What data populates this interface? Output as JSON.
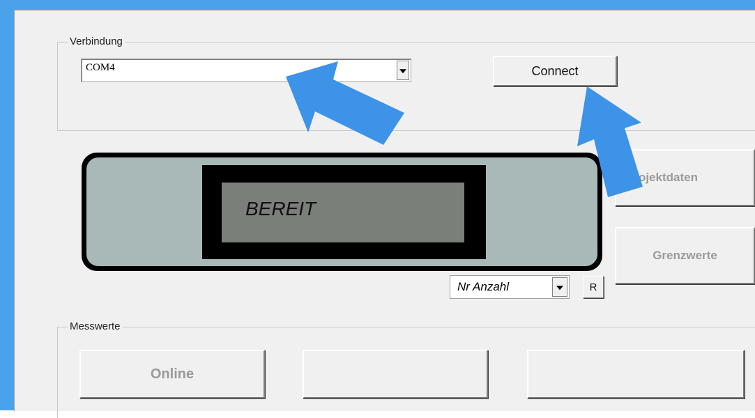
{
  "verbindung": {
    "group_label": "Verbindung",
    "port_value": "COM4",
    "connect_label": "Connect"
  },
  "display": {
    "status_text": "BEREIT"
  },
  "side_buttons": {
    "projektdaten_label": "Projektdaten",
    "grenzwerte_label": "Grenzwerte"
  },
  "counter": {
    "mode_value": "Nr Anzahl",
    "reset_label": "R"
  },
  "messwerte": {
    "group_label": "Messwerte",
    "online_label": "Online",
    "button2_label": "",
    "button3_label": ""
  },
  "colors": {
    "arrow": "#3d93e8",
    "titlebar": "#4aa3ea",
    "lcd_body": "#a9b9b8",
    "lcd_screen": "#7a7f79"
  },
  "icons": [
    "combo-dropdown-icon",
    "pointer-arrow-icon"
  ]
}
